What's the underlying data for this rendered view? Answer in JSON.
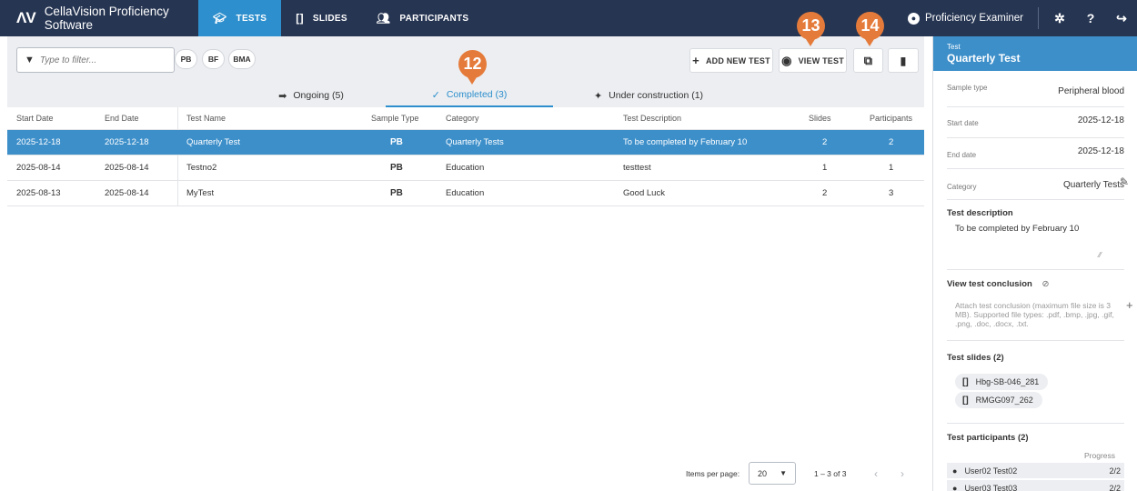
{
  "app": {
    "logo": "ΛV",
    "name": "CellaVision Proficiency Software"
  },
  "nav": {
    "tabs": [
      {
        "label": "TESTS",
        "icon": "graduation-cap-icon",
        "active": true
      },
      {
        "label": "SLIDES",
        "icon": "slides-icon",
        "active": false
      },
      {
        "label": "PARTICIPANTS",
        "icon": "people-icon",
        "active": false
      }
    ],
    "user": "Proficiency Examiner"
  },
  "toolbar": {
    "filter_placeholder": "Type to filter...",
    "chips": [
      "PB",
      "BF",
      "BMA"
    ],
    "add_new_test": "ADD NEW TEST",
    "view_test": "VIEW TEST"
  },
  "markers": [
    "12",
    "13",
    "14"
  ],
  "subtabs": [
    {
      "label": "Ongoing (5)",
      "icon": "arrow-right-icon",
      "active": false
    },
    {
      "label": "Completed (3)",
      "icon": "check-icon",
      "active": true
    },
    {
      "label": "Under construction (1)",
      "icon": "sparkle-icon",
      "active": false
    }
  ],
  "table": {
    "headers": [
      "Start Date",
      "End Date",
      "Test Name",
      "Sample Type",
      "Category",
      "Test Description",
      "Slides",
      "Participants"
    ],
    "rows": [
      {
        "start": "2025-12-18",
        "end": "2025-12-18",
        "name": "Quarterly Test",
        "sample": "PB",
        "category": "Quarterly Tests",
        "description": "To be completed by February 10",
        "slides": "2",
        "participants": "2",
        "selected": true
      },
      {
        "start": "2025-08-14",
        "end": "2025-08-14",
        "name": "Testno2",
        "sample": "PB",
        "category": "Education",
        "description": "testtest",
        "slides": "1",
        "participants": "1",
        "selected": false
      },
      {
        "start": "2025-08-13",
        "end": "2025-08-14",
        "name": "MyTest",
        "sample": "PB",
        "category": "Education",
        "description": "Good Luck",
        "slides": "2",
        "participants": "3",
        "selected": false
      }
    ]
  },
  "pager": {
    "label": "Items per page:",
    "per_page": "20",
    "range": "1 – 3 of 3"
  },
  "panel": {
    "header_label": "Test",
    "header_value": "Quarterly Test",
    "fields": [
      {
        "label": "Sample type",
        "value": "Peripheral blood"
      },
      {
        "label": "Start date",
        "value": "2025-12-18"
      },
      {
        "label": "End date",
        "value": "2025-12-18"
      },
      {
        "label": "Category",
        "value": "Quarterly Tests"
      }
    ],
    "description_title": "Test description",
    "description": "To be completed by February 10",
    "conclusion_title": "View test conclusion",
    "conclusion_hint": "Attach test conclusion (maximum file size is 3 MB). Supported file types: .pdf, .bmp, .jpg, .gif, .png, .doc, .docx, .txt.",
    "slides_title": "Test slides (2)",
    "slides": [
      "Hbg-SB-046_281",
      "RMGG097_262"
    ],
    "participants_title": "Test participants (2)",
    "progress_label": "Progress",
    "participants": [
      {
        "name": "User02 Test02",
        "progress": "2/2"
      },
      {
        "name": "User03 Test03",
        "progress": "2/2"
      }
    ]
  }
}
